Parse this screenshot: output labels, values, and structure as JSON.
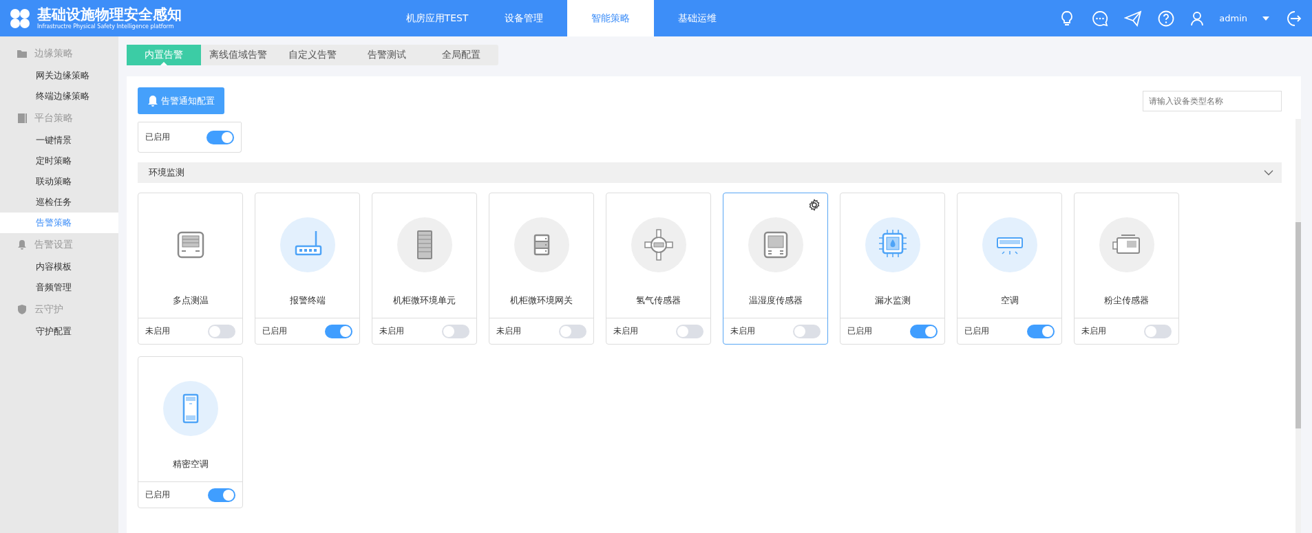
{
  "header": {
    "title": "基础设施物理安全感知",
    "subtitle": "Infrastructre Physical Safety Intelligence platform",
    "nav": [
      {
        "label": "机房应用TEST",
        "selected": false
      },
      {
        "label": "设备管理",
        "selected": false
      },
      {
        "label": "智能策略",
        "selected": true
      },
      {
        "label": "基础运维",
        "selected": false
      }
    ],
    "user": "admin"
  },
  "sidebar": {
    "sections": [
      {
        "title": "边缘策略",
        "kind": "folder",
        "items": [
          {
            "label": "网关边缘策略",
            "selected": false
          },
          {
            "label": "终端边缘策略",
            "selected": false
          }
        ]
      },
      {
        "title": "平台策略",
        "kind": "server",
        "items": [
          {
            "label": "一键情景",
            "selected": false
          },
          {
            "label": "定时策略",
            "selected": false
          },
          {
            "label": "联动策略",
            "selected": false
          },
          {
            "label": "巡检任务",
            "selected": false
          },
          {
            "label": "告警策略",
            "selected": true
          }
        ]
      },
      {
        "title": "告警设置",
        "kind": "bell",
        "items": [
          {
            "label": "内容模板",
            "selected": false
          },
          {
            "label": "音频管理",
            "selected": false
          }
        ]
      },
      {
        "title": "云守护",
        "kind": "shield",
        "items": [
          {
            "label": "守护配置",
            "selected": false
          }
        ]
      }
    ]
  },
  "tabs": [
    {
      "label": "内置告警",
      "selected": true
    },
    {
      "label": "离线值域告警",
      "selected": false
    },
    {
      "label": "自定义告警",
      "selected": false
    },
    {
      "label": "告警测试",
      "selected": false
    },
    {
      "label": "全局配置",
      "selected": false
    }
  ],
  "notify_button": "告警通知配置",
  "search": {
    "placeholder": "请输入设备类型名称"
  },
  "partial_card": {
    "status": "已启用",
    "on": true
  },
  "group": {
    "title": "环境监测",
    "expanded": true,
    "cards": [
      {
        "name": "多点测温",
        "kind": "panel",
        "status": "未启用",
        "on": false,
        "selected": false
      },
      {
        "name": "报警终端",
        "kind": "router",
        "status": "已启用",
        "on": true,
        "selected": false
      },
      {
        "name": "机柜微环境单元",
        "kind": "cabinet",
        "status": "未启用",
        "on": false,
        "selected": false
      },
      {
        "name": "机柜微环境网关",
        "kind": "server",
        "status": "未启用",
        "on": false,
        "selected": false
      },
      {
        "name": "氢气传感器",
        "kind": "gas",
        "status": "未启用",
        "on": false,
        "selected": false
      },
      {
        "name": "温湿度传感器",
        "kind": "screen",
        "status": "未启用",
        "on": false,
        "selected": true
      },
      {
        "name": "漏水监测",
        "kind": "water",
        "status": "已启用",
        "on": true,
        "selected": false
      },
      {
        "name": "空调",
        "kind": "ac",
        "status": "已启用",
        "on": true,
        "selected": false
      },
      {
        "name": "粉尘传感器",
        "kind": "dust",
        "status": "未启用",
        "on": false,
        "selected": false
      },
      {
        "name": "精密空调",
        "kind": "precise-ac",
        "status": "已启用",
        "on": true,
        "selected": false
      }
    ]
  }
}
